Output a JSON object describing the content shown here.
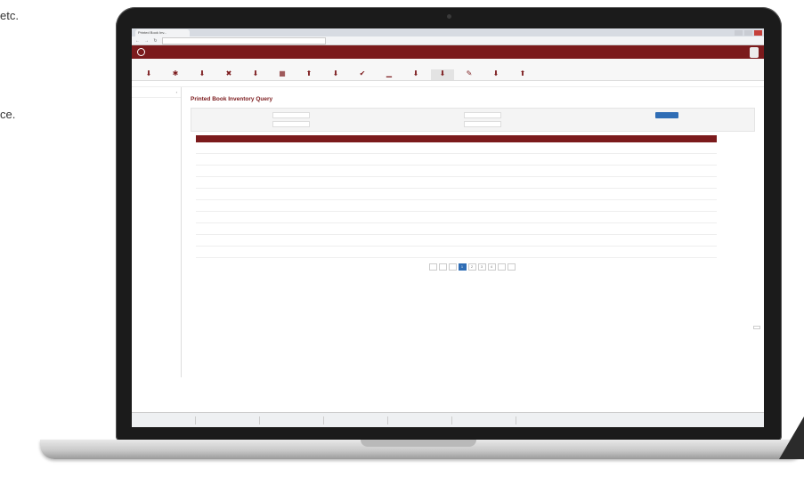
{
  "side_text": [
    "etc.",
    "ce."
  ],
  "browser": {
    "tab_title": "Printed Book Inv...",
    "window_title": "",
    "url": ""
  },
  "app": {
    "brand": "",
    "header_right": [
      "",
      "",
      ""
    ]
  },
  "toolbar": [
    {
      "label": "",
      "icon": "download-icon"
    },
    {
      "label": "",
      "icon": "star-icon"
    },
    {
      "label": "",
      "icon": "download-icon"
    },
    {
      "label": "",
      "icon": "close-icon"
    },
    {
      "label": "",
      "icon": "download-icon"
    },
    {
      "label": "",
      "icon": "grid-icon"
    },
    {
      "label": "",
      "icon": "upload-icon"
    },
    {
      "label": "",
      "icon": "download-icon"
    },
    {
      "label": "",
      "icon": "check-icon"
    },
    {
      "label": "",
      "icon": "chart-icon"
    },
    {
      "label": "",
      "icon": "download-icon"
    },
    {
      "label": "",
      "icon": "download-icon"
    },
    {
      "label": "",
      "icon": "pencil-icon"
    },
    {
      "label": "",
      "icon": "download-icon"
    },
    {
      "label": "",
      "icon": "upload-icon"
    }
  ],
  "sidebar": {
    "items": [
      ""
    ]
  },
  "main": {
    "title": "Printed Book Inventory Query",
    "search_button": "",
    "export_link": ""
  },
  "filters": {
    "labels": [
      "",
      "",
      "",
      "",
      "",
      ""
    ]
  },
  "table": {
    "headers": [
      "",
      "",
      "",
      "",
      "",
      "",
      "",
      "",
      "",
      "",
      "",
      "",
      ""
    ],
    "row_count": 10
  },
  "pager": {
    "pages": [
      "",
      "",
      "",
      "1",
      "2",
      "3",
      "4",
      "",
      ""
    ],
    "current": "1",
    "summary": "",
    "right": ""
  },
  "taskbar": {
    "items": [
      "",
      "",
      "",
      "",
      "",
      ""
    ],
    "right": ""
  },
  "colors": {
    "accent": "#7b1a1c",
    "link": "#2f6db5"
  }
}
